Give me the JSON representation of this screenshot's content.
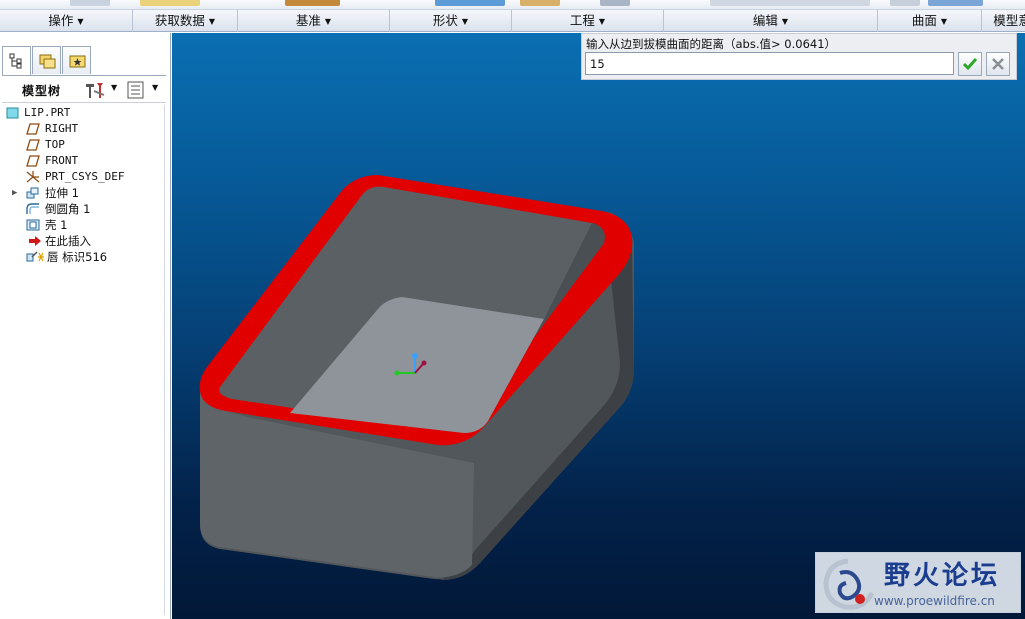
{
  "ribbon": {
    "groups": [
      {
        "label": "操作"
      },
      {
        "label": "获取数据"
      },
      {
        "label": "基准"
      },
      {
        "label": "形状"
      },
      {
        "label": "工程"
      },
      {
        "label": "编辑"
      },
      {
        "label": "曲面"
      },
      {
        "label": "模型意"
      }
    ]
  },
  "panel": {
    "tree_title": "模型树"
  },
  "tree": {
    "items": [
      {
        "label": "LIP.PRT",
        "icon": "part-icon"
      },
      {
        "label": "RIGHT",
        "icon": "datum-plane-icon"
      },
      {
        "label": "TOP",
        "icon": "datum-plane-icon"
      },
      {
        "label": "FRONT",
        "icon": "datum-plane-icon"
      },
      {
        "label": "PRT_CSYS_DEF",
        "icon": "csys-icon"
      },
      {
        "label": "拉伸 1",
        "icon": "extrude-icon"
      },
      {
        "label": "倒圆角 1",
        "icon": "round-icon"
      },
      {
        "label": "壳 1",
        "icon": "shell-icon"
      },
      {
        "label": "在此插入",
        "icon": "insert-here-arrow-icon"
      },
      {
        "label": "唇 标识516",
        "icon": "lip-feature-icon"
      }
    ]
  },
  "prompt": {
    "text": "输入从边到拔模曲面的距离（abs.值> 0.0641）",
    "value": "15"
  },
  "watermark": {
    "title": "野火论坛",
    "url": "www.proewildfire.cn"
  },
  "colors": {
    "viewport_top": "#0a6fb2",
    "viewport_bottom": "#021838",
    "lip_red": "#e00000",
    "model_gray": "#5c6165",
    "floor_gray": "#8e949a",
    "confirm_green": "#2fa52a"
  }
}
